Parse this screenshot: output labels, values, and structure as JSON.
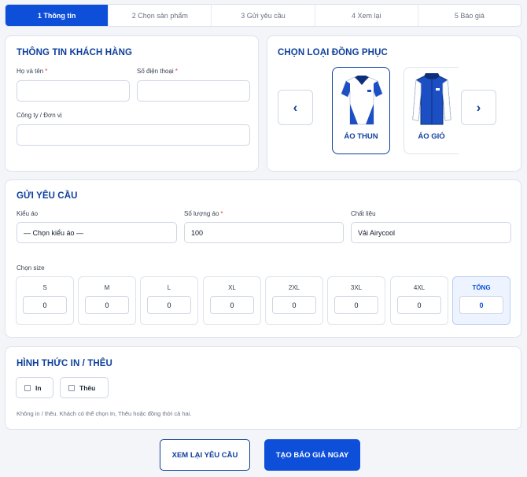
{
  "steps": [
    "1 Thông tin",
    "2 Chọn sản phẩm",
    "3 Gửi yêu cầu",
    "4 Xem lại",
    "5 Báo giá"
  ],
  "customer": {
    "title": "THÔNG TIN KHÁCH HÀNG",
    "name_label": "Họ và tên",
    "phone_label": "Số điện thoại",
    "company_label": "Công ty / Đơn vị",
    "required_mark": "*",
    "name_value": "",
    "phone_value": "",
    "company_value": ""
  },
  "uniform": {
    "title": "CHỌN LOẠI ĐỒNG PHỤC",
    "prev_glyph": "‹",
    "next_glyph": "›",
    "products": [
      {
        "label": "ÁO THUN",
        "icon": "polo-shirt-icon",
        "selected": true
      },
      {
        "label": "ÁO GIÓ",
        "icon": "jacket-icon",
        "selected": false
      }
    ]
  },
  "request": {
    "title": "GỬI YÊU CẦU",
    "type_label": "Kiểu áo",
    "type_value": "— Chọn kiểu áo —",
    "qty_label": "Số lượng áo",
    "qty_value": "100",
    "material_label": "Chất liệu",
    "material_value": "Vải Airycool",
    "size_label": "Chọn size",
    "sizes": [
      {
        "label": "S",
        "value": "0"
      },
      {
        "label": "M",
        "value": "0"
      },
      {
        "label": "L",
        "value": "0"
      },
      {
        "label": "XL",
        "value": "0"
      },
      {
        "label": "2XL",
        "value": "0"
      },
      {
        "label": "3XL",
        "value": "0"
      },
      {
        "label": "4XL",
        "value": "0"
      }
    ],
    "total_label": "TỔNG",
    "total_value": "0"
  },
  "print": {
    "title": "HÌNH THỨC IN / THÊU",
    "options": [
      {
        "label": "In",
        "checked": false
      },
      {
        "label": "Thêu",
        "checked": false
      }
    ],
    "hint": "Không in / thêu. Khách có thể chọn In, Thêu hoặc đồng thời cả hai."
  },
  "actions": {
    "review_label": "XEM LẠI YÊU CẦU",
    "quote_label": "TẠO BÁO GIÁ NGAY"
  },
  "colors": {
    "primary": "#0d4fd8",
    "heading": "#0d3f9c",
    "required": "#e53935"
  }
}
